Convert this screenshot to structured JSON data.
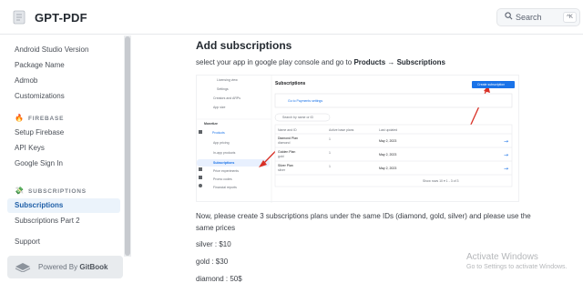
{
  "header": {
    "site_title": "GPT-PDF",
    "search_label": "Search",
    "search_shortcut": "^K"
  },
  "sidebar": {
    "items_top": [
      {
        "label": "Android Studio Version"
      },
      {
        "label": "Package Name"
      },
      {
        "label": "Admob"
      },
      {
        "label": "Customizations"
      }
    ],
    "firebase_heading": "FIREBASE",
    "firebase_items": [
      {
        "label": "Setup Firebase"
      },
      {
        "label": "API Keys"
      },
      {
        "label": "Google Sign In"
      }
    ],
    "subscriptions_heading": "SUBSCRIPTIONS",
    "subscriptions_items": [
      {
        "label": "Subscriptions",
        "active": true
      },
      {
        "label": "Subscriptions Part 2"
      }
    ],
    "support": "Support",
    "powered_by_prefix": "Powered By",
    "powered_by_brand": "GitBook"
  },
  "main": {
    "heading": "Add subscriptions",
    "intro_text": "select your app in google play console and go to",
    "intro_bold": "Products → Subscriptions",
    "para": "Now, please create 3 subscriptions plans under the same IDs (diamond, gold, silver) and please use the same prices",
    "prices": [
      "silver : $10",
      "gold : $30",
      "diamond : 50$"
    ]
  },
  "embedded_screenshot": {
    "left_menu": [
      "Licensing view",
      "Settings",
      "Creators and ARPs",
      "App size"
    ],
    "monetize_label": "Monetize",
    "products_label": "Products",
    "product_items": [
      "App pricing",
      "In-app products",
      "Subscriptions"
    ],
    "other_items": [
      "Price experiments",
      "Promo codes",
      "Financial reports"
    ],
    "title": "Subscriptions",
    "create_button": "Create subscription",
    "payments_link": "Go to Payments settings",
    "search_placeholder": "Search by name or ID",
    "columns": [
      "Name and ID",
      "Active base plans",
      "Last updated"
    ],
    "rows": [
      {
        "name": "Diamond Plan",
        "id": "diamond",
        "plans": "1",
        "updated": "May 2, 2023"
      },
      {
        "name": "Golden Plan",
        "id": "gold",
        "plans": "1",
        "updated": "May 2, 2023"
      },
      {
        "name": "Silver Plan",
        "id": "silver",
        "plans": "1",
        "updated": "May 2, 2023"
      }
    ],
    "pagination": "Show rows  10 ▾    1 - 3 of 3"
  },
  "watermark": {
    "line1": "Activate Windows",
    "line2": "Go to Settings to activate Windows."
  },
  "colors": {
    "accent": "#1f5fa8",
    "active_bg": "#ebf3fb",
    "play_blue": "#1a73e8",
    "arrow_red": "#d93025"
  }
}
